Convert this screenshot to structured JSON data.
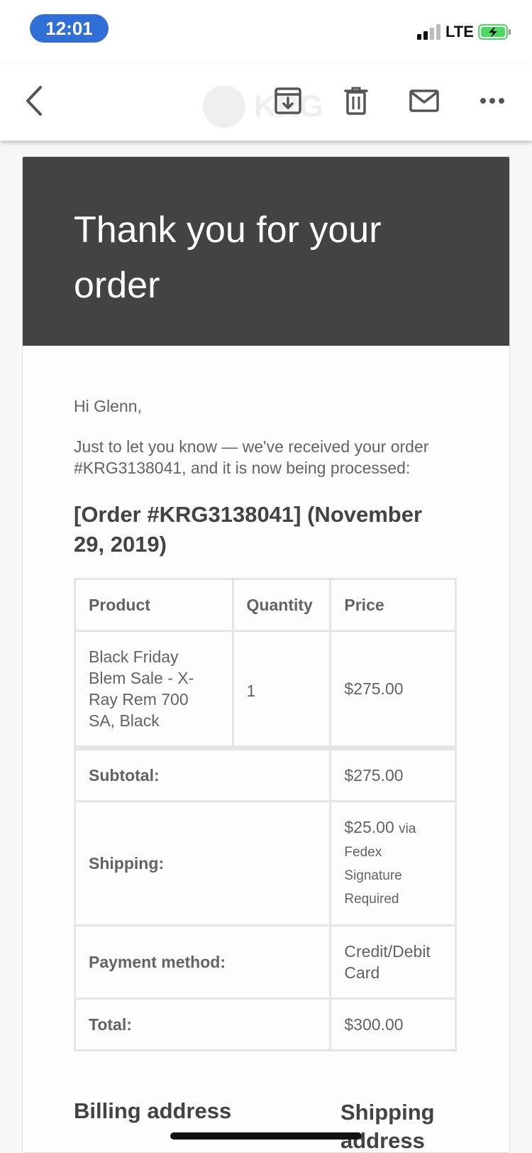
{
  "status_bar": {
    "time": "12:01",
    "network": "LTE",
    "accent_color": "#2f6fd6",
    "battery_color": "#4cd964"
  },
  "toolbar": {
    "back_icon": "chevron-left-icon",
    "archive_icon": "archive-icon",
    "delete_icon": "trash-icon",
    "mark_unread_icon": "envelope-icon",
    "more_icon": "more-horizontal-icon",
    "watermark_text": "KRG"
  },
  "email": {
    "header_title": "Thank you for your order",
    "header_bg": "#434343",
    "greeting": "Hi Glenn,",
    "intro": "Just to let you know — we've received your order #KRG3138041, and it is now being processed:",
    "order_heading": "[Order #KRG3138041] (November 29, 2019)",
    "table": {
      "headers": [
        "Product",
        "Quantity",
        "Price"
      ],
      "items": [
        {
          "product": "Black Friday Blem Sale - X-Ray Rem 700 SA, Black",
          "quantity": "1",
          "price": "$275.00"
        }
      ],
      "subtotal_label": "Subtotal:",
      "subtotal_value": "$275.00",
      "shipping_label": "Shipping:",
      "shipping_amount": "$25.00",
      "shipping_method": "via Fedex Signature Required",
      "payment_label": "Payment method:",
      "payment_value": "Credit/Debit Card",
      "total_label": "Total:",
      "total_value": "$300.00"
    },
    "billing_heading": "Billing address",
    "shipping_heading": "Shipping address"
  }
}
